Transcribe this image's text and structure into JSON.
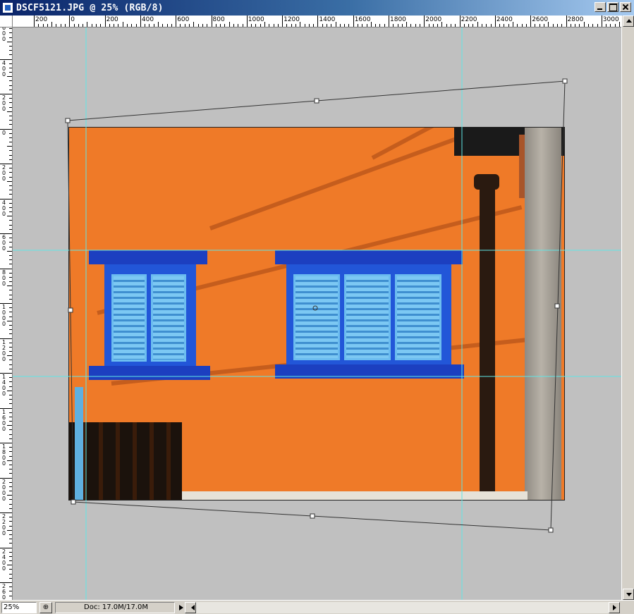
{
  "window": {
    "title": "DSCF5121.JPG @ 25% (RGB/8)",
    "controls": [
      "minimize",
      "maximize",
      "close"
    ]
  },
  "ruler_top": {
    "labels": [
      "200",
      "0",
      "200",
      "400",
      "600",
      "800",
      "1000",
      "1200",
      "1400",
      "1600",
      "1800",
      "2000",
      "2200",
      "2400",
      "2600",
      "2800",
      "3000"
    ]
  },
  "ruler_left": {
    "labels": [
      "600",
      "400",
      "200",
      "0",
      "200",
      "400",
      "600",
      "800",
      "1000",
      "1200",
      "1400",
      "1600",
      "1800",
      "2000",
      "2200",
      "2400",
      "2600"
    ]
  },
  "status": {
    "zoom": "25%",
    "doc": "Doc: 17.0M/17.0M"
  },
  "colors": {
    "canvas": "#c0c0c0",
    "guide": "#5fe6e6",
    "wall": "#ef7a28",
    "shutter_frame": "#1c3fc0",
    "shutter": "#7cc8f3"
  },
  "icons": {
    "app": "photoshop-doc-icon",
    "status_button": "status-menu-icon"
  }
}
